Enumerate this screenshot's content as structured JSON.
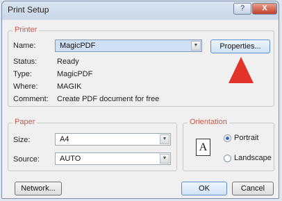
{
  "window": {
    "title": "Print Setup",
    "help_glyph": "?",
    "close_glyph": "X"
  },
  "printer": {
    "group_label": "Printer",
    "name_label": "Name:",
    "name_value": "MagicPDF",
    "properties_button": "Properties...",
    "status_label": "Status:",
    "status_value": "Ready",
    "type_label": "Type:",
    "type_value": "MagicPDF",
    "where_label": "Where:",
    "where_value": "MAGIK",
    "comment_label": "Comment:",
    "comment_value": "Create PDF document for free"
  },
  "paper": {
    "group_label": "Paper",
    "size_label": "Size:",
    "size_value": "A4",
    "source_label": "Source:",
    "source_value": "AUTO"
  },
  "orientation": {
    "group_label": "Orientation",
    "icon_letter": "A",
    "portrait_label": "Portrait",
    "landscape_label": "Landscape",
    "selected": "Portrait"
  },
  "footer": {
    "network_button": "Network...",
    "ok_button": "OK",
    "cancel_button": "Cancel"
  },
  "annotation": {
    "color": "#e2332a"
  },
  "icons": {
    "dropdown": "chevron-down-icon",
    "help": "help-icon",
    "close": "close-icon",
    "orientation": "portrait-page-icon"
  }
}
